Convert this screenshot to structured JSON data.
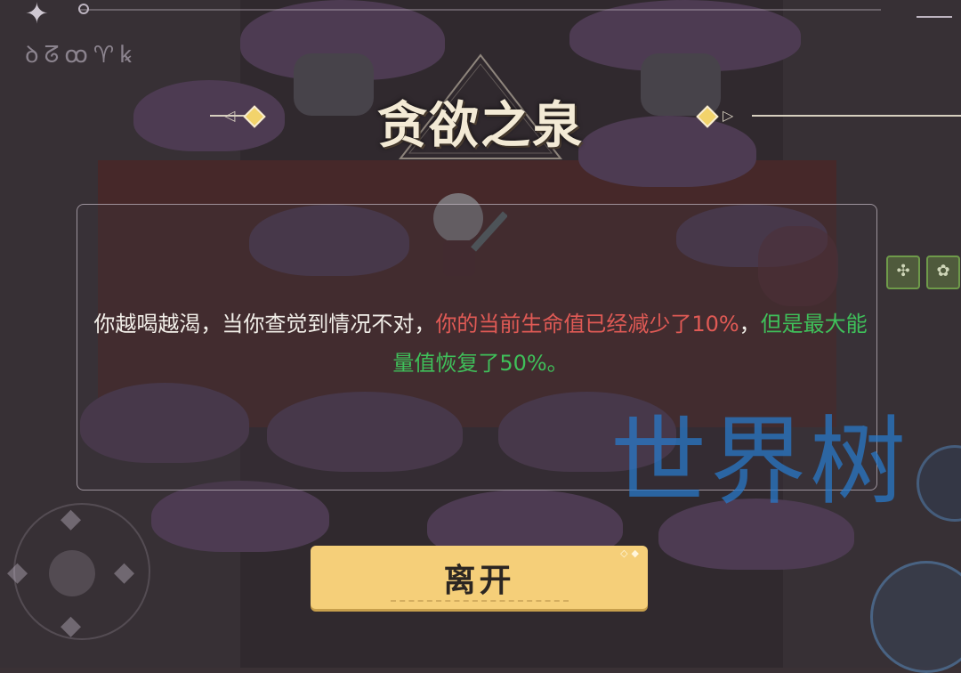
{
  "title": "贪欲之泉",
  "runes": "ꝺᘔꝏ♈ꝃ",
  "message": {
    "normal": "你越喝越渴，当你查觉到情况不对，",
    "red_part": "你的当前生命值已经减少了10%",
    "sep": "，",
    "green_part": "但是最大能量值恢复了50%。"
  },
  "leave_button": {
    "label": "离开"
  },
  "watermark": "世界树",
  "hud": {
    "skill_slots": [
      "✣",
      "✿"
    ]
  },
  "colors": {
    "accent_gold": "#f5cf79",
    "warn_red": "#e05a55",
    "buff_green": "#3fc05a"
  }
}
